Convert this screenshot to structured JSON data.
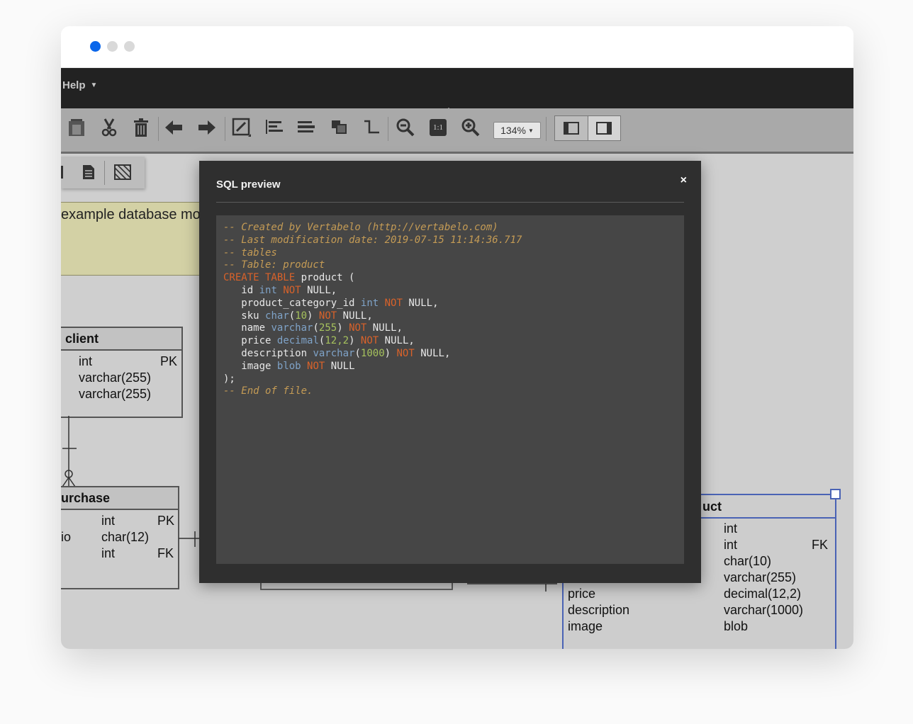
{
  "window": {
    "traffic_colors": [
      "#0a66ea",
      "#d9d9d9",
      "#d9d9d9"
    ]
  },
  "menubar": {
    "help_label": "Help"
  },
  "toolbar": {
    "icons": [
      "paste-icon",
      "cut-icon",
      "delete-icon",
      "undo-icon",
      "redo-icon",
      "edit-icon",
      "align-left-icon",
      "align-distribute-icon",
      "arrange-icon",
      "connector-icon",
      "zoom-out-icon",
      "actual-size-icon",
      "zoom-in-icon"
    ],
    "actual_size_label": "1:1",
    "zoom_value": "134%"
  },
  "canvas": {
    "note_text": "example database mo",
    "entities": {
      "client": {
        "name": "client",
        "rows": [
          {
            "type": "int",
            "key": "PK"
          },
          {
            "type": "varchar(255)",
            "key": ""
          },
          {
            "type": "varchar(255)",
            "key": ""
          }
        ]
      },
      "purchase": {
        "name": "urchase",
        "rows": [
          {
            "name": "",
            "type": "int",
            "key": "PK"
          },
          {
            "name": "io",
            "type": "char(12)",
            "key": ""
          },
          {
            "name": "",
            "type": "int",
            "key": "FK"
          }
        ]
      },
      "product": {
        "name": "uct",
        "rows": [
          {
            "name": "",
            "type": "int",
            "key": ""
          },
          {
            "name": "",
            "type": "int",
            "key": "FK"
          },
          {
            "name": "",
            "type": "char(10)",
            "key": ""
          },
          {
            "name": "",
            "type": "varchar(255)",
            "key": ""
          },
          {
            "name": "price",
            "type": "decimal(12,2)",
            "key": ""
          },
          {
            "name": "description",
            "type": "varchar(1000)",
            "key": ""
          },
          {
            "name": "image",
            "type": "blob",
            "key": ""
          }
        ]
      }
    }
  },
  "modal": {
    "title": "SQL preview",
    "close_label": "×",
    "sql": {
      "comment_created": "-- Created by Vertabelo (http://vertabelo.com)",
      "comment_modified": "-- Last modification date: 2019-07-15 11:14:36.717",
      "comment_tables": "-- tables",
      "comment_table": "-- Table: product",
      "kw_create": "CREATE TABLE",
      "table_name": " product (",
      "columns": [
        {
          "name": "id",
          "type": "int",
          "args": ""
        },
        {
          "name": "product_category_id",
          "type": "int",
          "args": ""
        },
        {
          "name": "sku",
          "type": "char",
          "args": "10"
        },
        {
          "name": "name",
          "type": "varchar",
          "args": "255"
        },
        {
          "name": "price",
          "type": "decimal",
          "args": "12,2"
        },
        {
          "name": "description",
          "type": "varchar",
          "args": "1000"
        },
        {
          "name": "image",
          "type": "blob",
          "args": ""
        }
      ],
      "kw_not": "NOT",
      "kw_null": "NULL",
      "close_paren": ");",
      "comment_end": "-- End of file."
    }
  }
}
